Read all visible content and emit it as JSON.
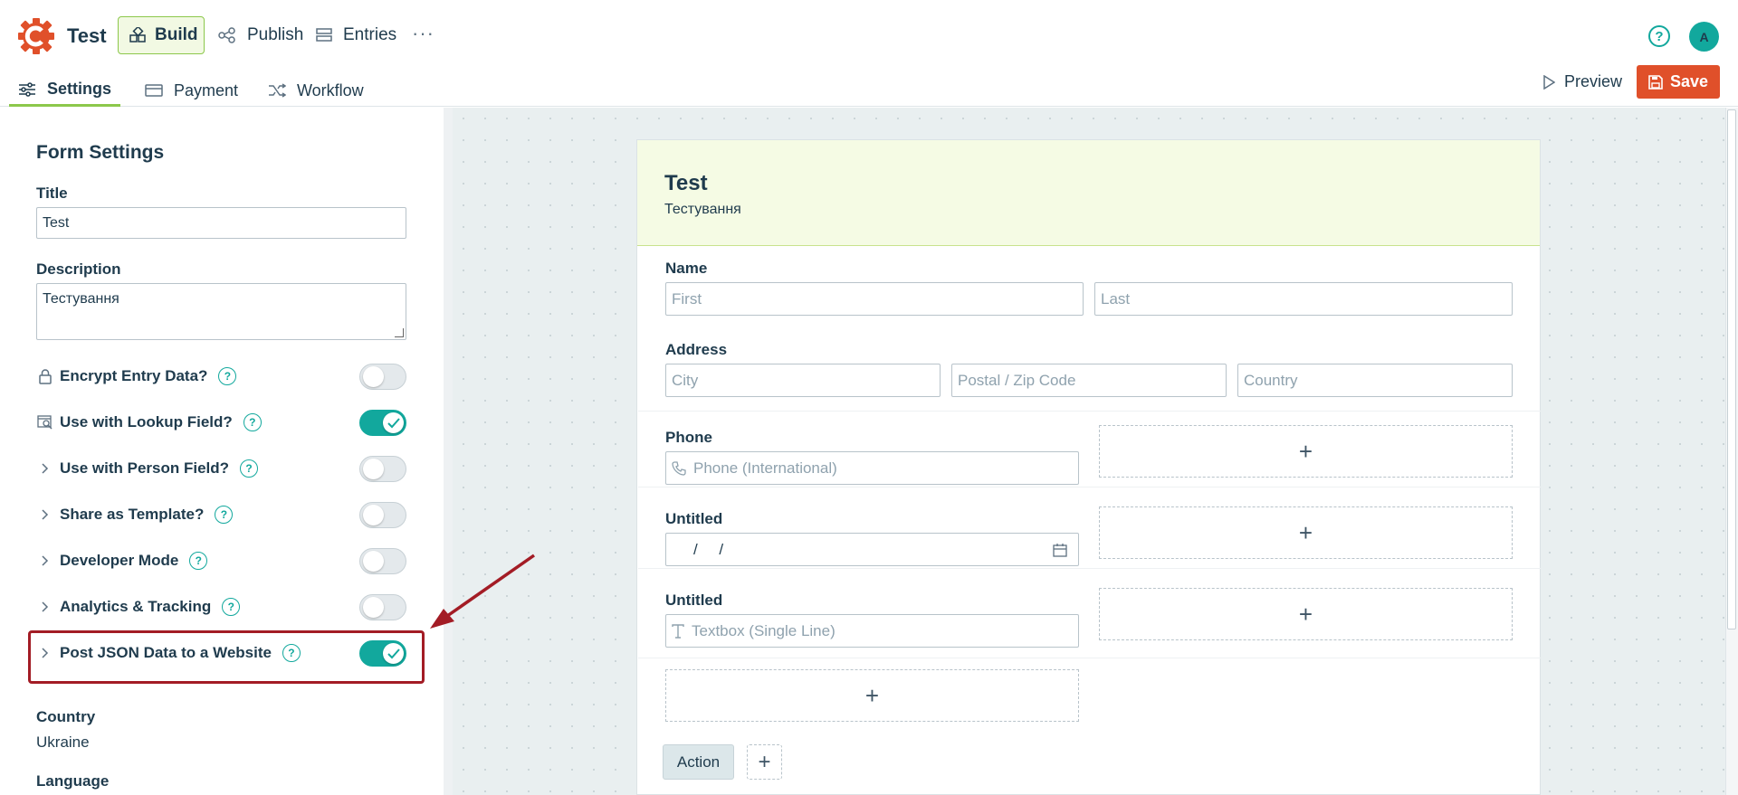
{
  "app": {
    "name": "Test",
    "nav": {
      "build": "Build",
      "publish": "Publish",
      "entries": "Entries",
      "more": "···"
    },
    "help": "?",
    "avatar": "A"
  },
  "subtabs": {
    "settings": "Settings",
    "payment": "Payment",
    "workflow": "Workflow",
    "preview": "Preview",
    "save": "Save"
  },
  "sidebar": {
    "title": "Form Settings",
    "title_label": "Title",
    "title_value": "Test",
    "description_label": "Description",
    "description_value": "Тестування",
    "settings": [
      {
        "label": "Encrypt Entry Data?",
        "icon": "lock-icon",
        "on": false
      },
      {
        "label": "Use with Lookup Field?",
        "icon": "lookup-icon",
        "on": true
      },
      {
        "label": "Use with Person Field?",
        "icon": "chevron-right-icon",
        "on": false
      },
      {
        "label": "Share as Template?",
        "icon": "chevron-right-icon",
        "on": false
      },
      {
        "label": "Developer Mode",
        "icon": "chevron-right-icon",
        "on": false
      },
      {
        "label": "Analytics & Tracking",
        "icon": "chevron-right-icon",
        "on": false
      },
      {
        "label": "Post JSON Data to a Website",
        "icon": "chevron-right-icon",
        "on": true
      }
    ],
    "country_label": "Country",
    "country_value": "Ukraine",
    "language_label": "Language"
  },
  "form": {
    "title": "Test",
    "description": "Тестування",
    "name_label": "Name",
    "name_first_placeholder": "First",
    "name_last_placeholder": "Last",
    "address_label": "Address",
    "address_city_placeholder": "City",
    "address_zip_placeholder": "Postal / Zip Code",
    "address_country_placeholder": "Country",
    "phone_label": "Phone",
    "phone_placeholder": "Phone (International)",
    "date_label": "Untitled",
    "date_placeholder": "/     /",
    "textbox_label": "Untitled",
    "textbox_placeholder": "Textbox (Single Line)",
    "add_symbol": "+",
    "action_label": "Action"
  },
  "colors": {
    "accent": "#12a89d",
    "save": "#e0502a",
    "build_bg": "#f2f9e3",
    "highlight": "#a31c25"
  }
}
